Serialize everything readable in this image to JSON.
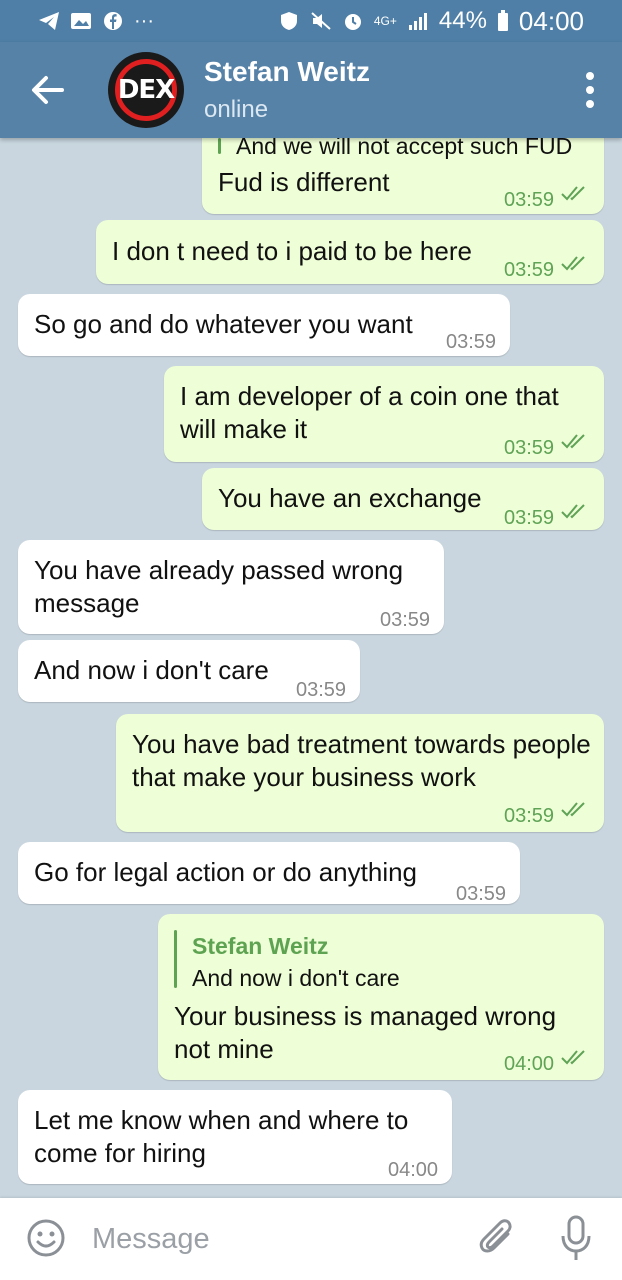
{
  "status_bar": {
    "network": "4G+",
    "battery": "44%",
    "time": "04:00"
  },
  "header": {
    "avatar_text": "DEX",
    "title": "Stefan Weitz",
    "subtitle": "online"
  },
  "messages": [
    {
      "side": "out",
      "quote_fragment": "And we will not accept such FUD",
      "text": "Fud is different",
      "time": "03:59"
    },
    {
      "side": "out",
      "text": "I don t need to i paid to be here",
      "time": "03:59"
    },
    {
      "side": "in",
      "text": "So go and do whatever you want",
      "time": "03:59"
    },
    {
      "side": "out",
      "text": "I am developer of a coin one that will make it",
      "time": "03:59"
    },
    {
      "side": "out",
      "text": "You have an exchange",
      "time": "03:59"
    },
    {
      "side": "in",
      "text": "You have already passed wrong message",
      "time": "03:59"
    },
    {
      "side": "in",
      "text": "And now i don't care",
      "time": "03:59"
    },
    {
      "side": "out",
      "text": "You have bad treatment towards people that make your business work",
      "time": "03:59"
    },
    {
      "side": "in",
      "text": "Go for legal action or do anything",
      "time": "03:59"
    },
    {
      "side": "out",
      "reply_name": "Stefan Weitz",
      "reply_text": "And now i don't care",
      "text": "Your business is managed wrong not mine",
      "time": "04:00"
    },
    {
      "side": "in",
      "text": "Let me know when and where to come for hiring",
      "time": "04:00"
    }
  ],
  "input": {
    "placeholder": "Message"
  },
  "colors": {
    "header": "#5682a8",
    "outgoing_bubble": "#eefed6",
    "incoming_bubble": "#ffffff",
    "accent_green": "#5da352"
  }
}
